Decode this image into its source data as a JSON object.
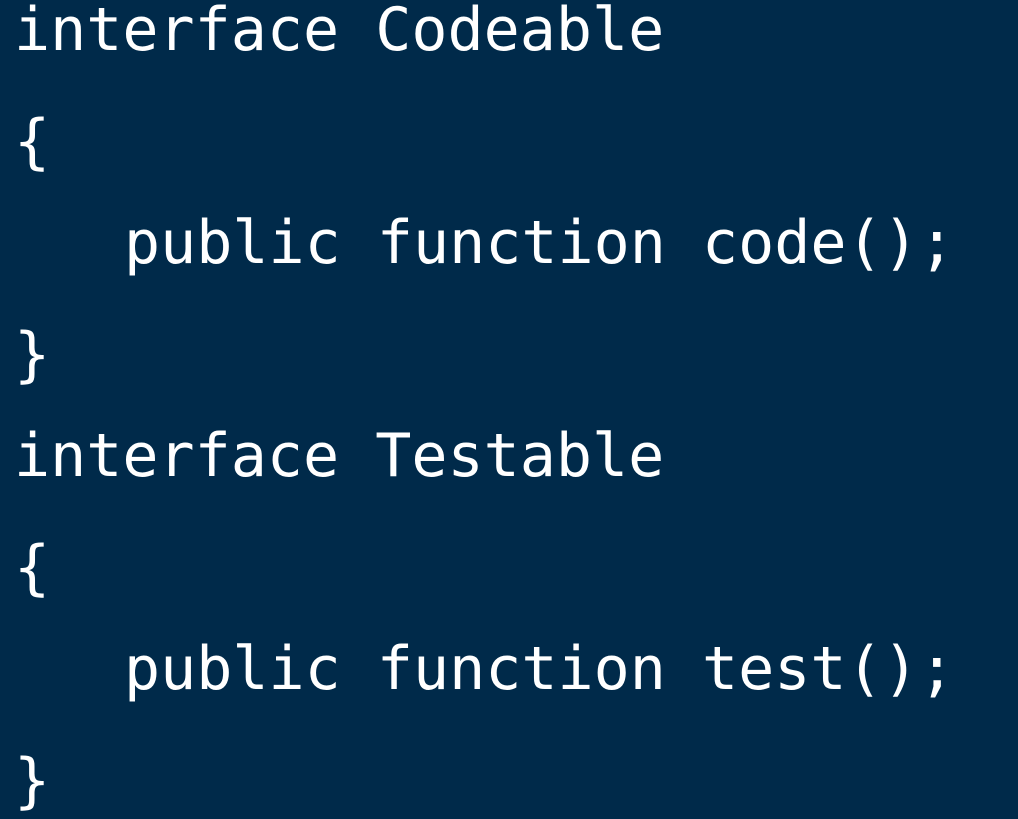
{
  "code": {
    "lines": [
      "interface Codeable",
      "{",
      "public function code();",
      "}",
      "interface Testable",
      "{",
      "public function test();",
      "}"
    ]
  },
  "colors": {
    "background": "#002a4a",
    "text": "#ffffff"
  }
}
